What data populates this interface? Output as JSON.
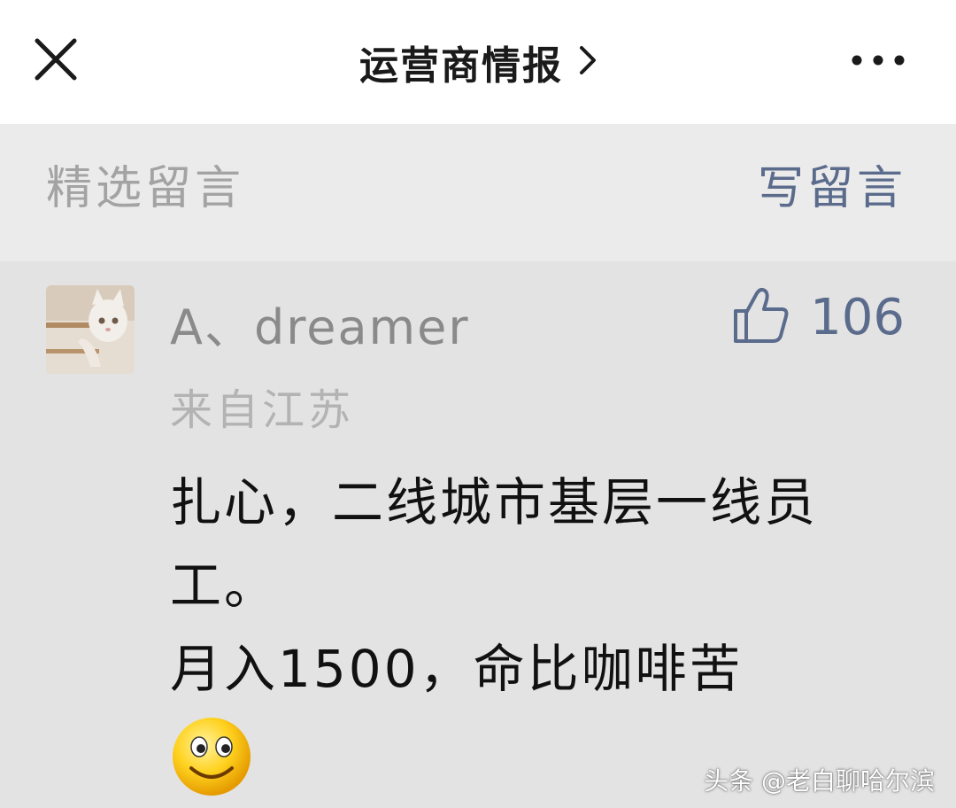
{
  "header": {
    "title": "运营商情报",
    "close_icon": "close-icon",
    "chevron_icon": "chevron-right-icon",
    "more_icon": "more-dots-icon"
  },
  "comments_section": {
    "title": "精选留言",
    "write_label": "写留言"
  },
  "comment": {
    "username": "A、dreamer",
    "like_icon": "thumbs-up-icon",
    "like_count": "106",
    "location": "来自江苏",
    "lines": [
      "扎心，二线城市基层一线员工。",
      "月入1500，命比咖啡苦"
    ],
    "emoji_icon": "smiley-emoji-icon"
  },
  "watermark": "头条 @老白聊哈尔滨",
  "colors": {
    "accent": "#5b6b8c",
    "background": "#e3e3e3",
    "header_bg": "#ffffff",
    "muted_text": "#a3a3a3"
  }
}
